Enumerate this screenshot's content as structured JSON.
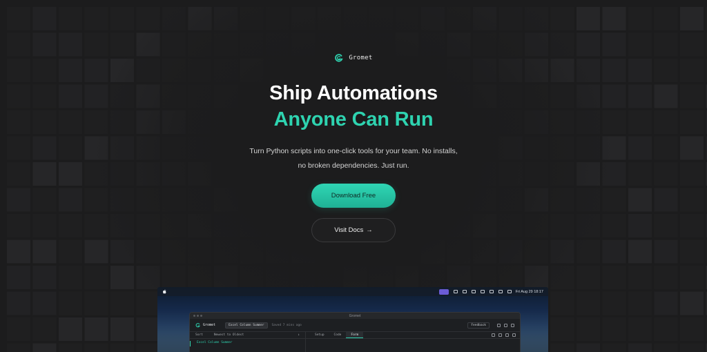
{
  "brand": {
    "name": "Gromet",
    "icon": "gromet-logo-icon",
    "accent": "#2ed3b0"
  },
  "hero": {
    "title_line1": "Ship Automations",
    "title_line2": "Anyone Can Run",
    "subtitle_line1": "Turn Python scripts into one-click tools for your team. No installs,",
    "subtitle_line2": "no broken dependencies. Just run.",
    "primary_cta": "Download Free",
    "secondary_cta": "Visit Docs",
    "secondary_cta_icon": "arrow-right-icon",
    "secondary_cta_arrow": "→"
  },
  "preview": {
    "menubar": {
      "clock": "Fri Aug 29  18:17"
    },
    "window_title": "Gromet",
    "toolbar": {
      "app_name": "Gromet",
      "script_chip": "Excel Column Summer",
      "saved_status": "Saved 7 mins ago",
      "feedback": "Feedback"
    },
    "subbar": {
      "sort_label": "Sort",
      "sort_value": "Newest to Oldest",
      "tabs": [
        "Setup",
        "Code",
        "Form"
      ],
      "active_tab": "Form"
    },
    "list": {
      "first_item": "Excel Column Summer"
    }
  }
}
